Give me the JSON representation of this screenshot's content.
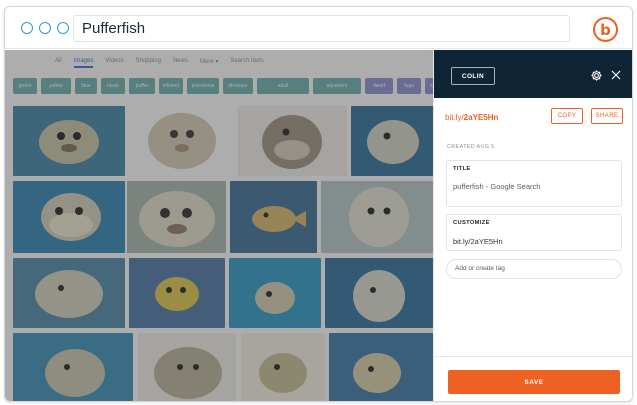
{
  "browser": {
    "url_text": "Pufferfish",
    "logo_letter": "b"
  },
  "background_page": {
    "tabs": [
      "All",
      "Images",
      "Videos",
      "Shopping",
      "News",
      "More ▾",
      "Search tools"
    ],
    "active_tab_index": 1,
    "chips": [
      {
        "label": "green",
        "color": "#6ab0b0"
      },
      {
        "label": "yellow",
        "color": "#6ab0b0"
      },
      {
        "label": "blue",
        "color": "#6ab0b0"
      },
      {
        "label": "black",
        "color": "#6ab0b0"
      },
      {
        "label": "puffer",
        "color": "#6ab0b0"
      },
      {
        "label": "inflated",
        "color": "#6ab0b0"
      },
      {
        "label": "poisonous",
        "color": "#6ab0b0"
      },
      {
        "label": "dinosaur",
        "color": "#6ab0b0"
      },
      {
        "label": "adult",
        "color": "#6ab0b0"
      },
      {
        "label": "aquarium",
        "color": "#6ab0b0"
      },
      {
        "label": "dwarf",
        "color": "#8d8fd6"
      },
      {
        "label": "fugu",
        "color": "#8d8fd6"
      },
      {
        "label": "saltwater",
        "color": "#8d8fd6"
      }
    ]
  },
  "panel": {
    "user_button": "COLIN",
    "short_link": {
      "domain": "bit.ly/",
      "code": "2aYE5Hn"
    },
    "copy_label": "COPY",
    "share_label": "SHARE",
    "created_label": "CREATED AUG 5",
    "title_field": {
      "label": "TITLE",
      "value": "pufferfish - Google Search"
    },
    "customize_field": {
      "label": "CUSTOMIZE",
      "value": "bit.ly/2aYE5Hn"
    },
    "tag_placeholder": "Add or create tag",
    "save_label": "SAVE"
  },
  "colors": {
    "accent": "#ee6123",
    "panel_header": "#0f2535",
    "browser_dots": "#2f9bd6"
  },
  "icons": [
    "gear-icon",
    "close-icon",
    "bitly-logo-icon"
  ]
}
